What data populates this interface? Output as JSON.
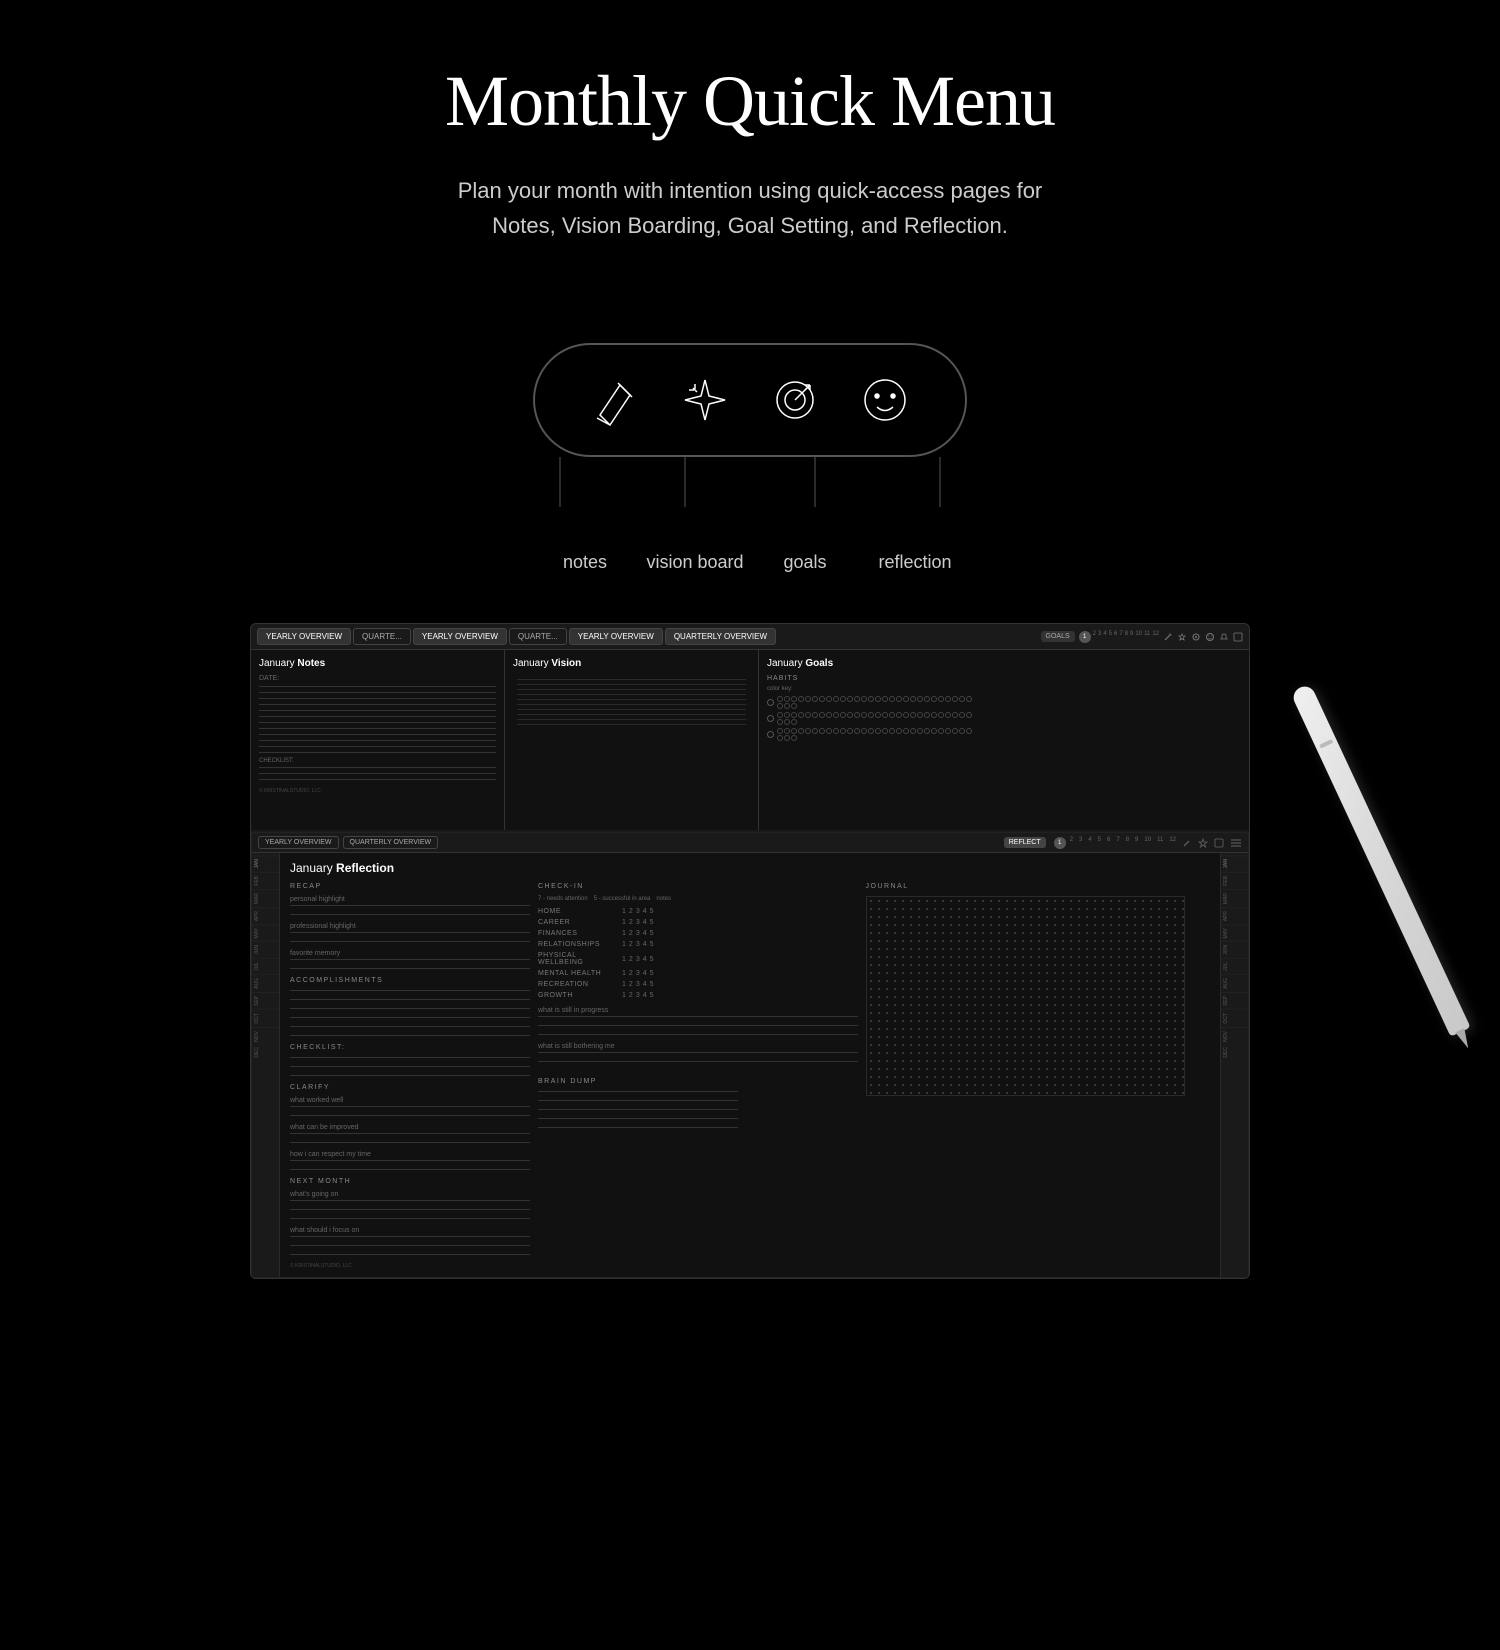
{
  "hero": {
    "title": "Monthly Quick Menu",
    "subtitle_line1": "Plan your month with intention using quick-access pages for",
    "subtitle_line2": "Notes, Vision Boarding, Goal Setting, and Reflection."
  },
  "icons": {
    "items": [
      {
        "name": "notes",
        "label": "notes",
        "icon": "pencil"
      },
      {
        "name": "vision-board",
        "label": "vision board",
        "icon": "sparkle"
      },
      {
        "name": "goals",
        "label": "goals",
        "icon": "target"
      },
      {
        "name": "reflection",
        "label": "reflection",
        "icon": "smiley"
      }
    ]
  },
  "mockup": {
    "tabs": [
      "YEARLY OVERVIEW",
      "QUARTE",
      "YEARLY OVERVIEW",
      "QUARTE",
      "YEARLY OVERVIEW",
      "QUARTERLY OVERVIEW"
    ],
    "panels": {
      "notes": {
        "title": "January",
        "title_bold": "Notes",
        "date_label": "DATE:"
      },
      "vision": {
        "title": "January",
        "title_bold": "Vision"
      },
      "goals": {
        "title": "January",
        "title_bold": "Goals",
        "habits_label": "HABITS",
        "color_key_label": "color key:"
      }
    },
    "goals_nums": [
      "1",
      "2",
      "3",
      "4",
      "5",
      "6",
      "7",
      "8",
      "9",
      "10",
      "11",
      "12"
    ],
    "reflect_nums": [
      "1",
      "2",
      "3",
      "4",
      "5",
      "6",
      "7",
      "8",
      "9",
      "10",
      "11",
      "12"
    ],
    "reflection": {
      "title": "January",
      "title_bold": "Reflection",
      "tabs": [
        "YEARLY OVERVIEW",
        "QUARTERLY OVERVIEW"
      ],
      "active_tab_label": "REFLECT",
      "sections": {
        "recap": {
          "heading": "RECAP",
          "fields": [
            "personal highlight",
            "professional highlight",
            "favorite memory"
          ]
        },
        "accomplishments": {
          "heading": "ACCOMPLISHMENTS"
        },
        "checklist": {
          "heading": "CHECKLIST:"
        },
        "checkin": {
          "heading": "CHECK-IN",
          "hint1": "7 - needs attention",
          "hint2": "5 - successful in area",
          "hint3": "notes",
          "areas": [
            "HOME",
            "CAREER",
            "FINANCES",
            "RELATIONSHIPS",
            "PHYSICAL WELLBEING",
            "MENTAL HEALTH",
            "RECREATION",
            "GROWTH"
          ],
          "scale": [
            "1",
            "2",
            "3",
            "4",
            "5"
          ]
        },
        "clarify": {
          "heading": "CLARIFY",
          "fields": [
            "what worked well",
            "what can be improved",
            "how i can respect my time"
          ]
        },
        "next_month": {
          "heading": "NEXT MONTH",
          "fields": [
            "what's going on",
            "what should i focus on"
          ]
        },
        "journal": {
          "heading": "JOURNAL"
        },
        "brain_dump": {
          "heading": "BRAIN DUMP"
        },
        "in_progress": {
          "label": "what is still in progress"
        },
        "bothering": {
          "label": "what is still bothering me"
        }
      }
    },
    "months_sidebar": [
      "JAN",
      "FEB",
      "MAR",
      "APR",
      "MAY",
      "JUN",
      "JUL",
      "AUG",
      "SEP",
      "OCT",
      "NOV",
      "DEC"
    ],
    "months_sidebar_right": [
      "FEB",
      "MAR",
      "APR",
      "MAY",
      "JUN",
      "JUL",
      "AUG",
      "SEP",
      "OCT",
      "NOV",
      "DEC",
      "JAN"
    ],
    "copyright": "© KRISTINALSTUDIO, LLC"
  }
}
